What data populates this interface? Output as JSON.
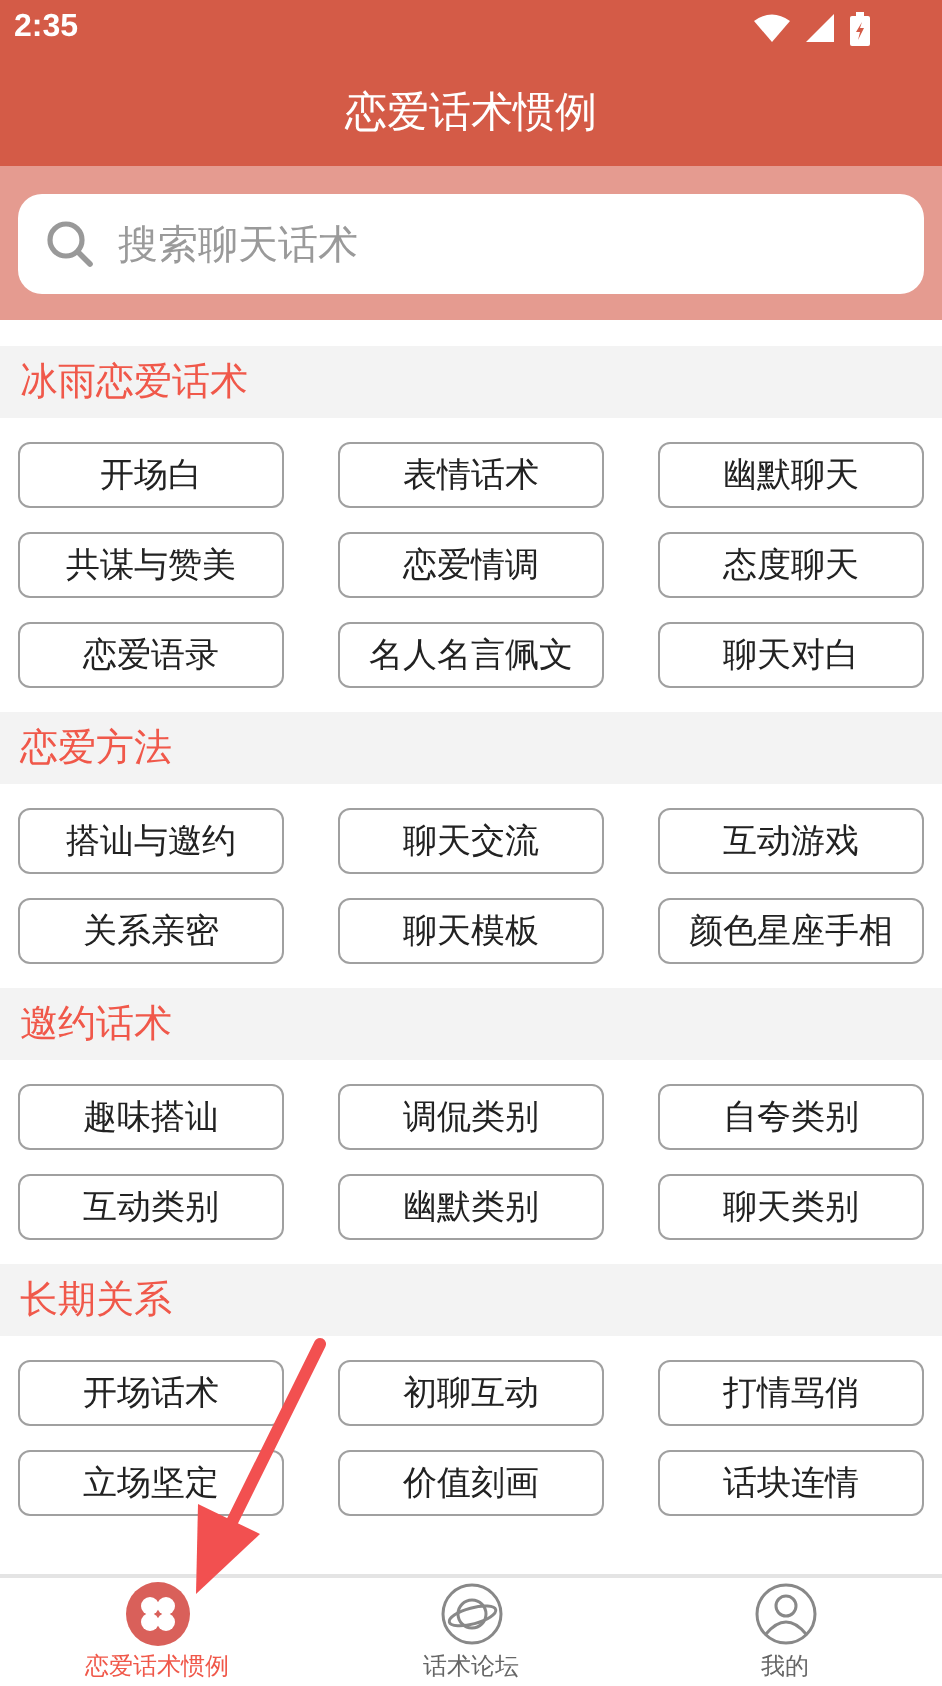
{
  "status_bar": {
    "time": "2:35"
  },
  "header": {
    "title": "恋爱话术惯例"
  },
  "search": {
    "placeholder": "搜索聊天话术"
  },
  "sections": [
    {
      "title": "冰雨恋爱话术",
      "items": [
        "开场白",
        "表情话术",
        "幽默聊天",
        "共谋与赞美",
        "恋爱情调",
        "态度聊天",
        "恋爱语录",
        "名人名言佩文",
        "聊天对白"
      ]
    },
    {
      "title": "恋爱方法",
      "items": [
        "搭讪与邀约",
        "聊天交流",
        "互动游戏",
        "关系亲密",
        "聊天模板",
        "颜色星座手相"
      ]
    },
    {
      "title": "邀约话术",
      "items": [
        "趣味搭讪",
        "调侃类别",
        "自夸类别",
        "互动类别",
        "幽默类别",
        "聊天类别"
      ]
    },
    {
      "title": "长期关系",
      "items": [
        "开场话术",
        "初聊互动",
        "打情骂俏",
        "立场坚定",
        "价值刻画",
        "话块连情"
      ]
    }
  ],
  "tab_bar": [
    {
      "label": "恋爱话术惯例",
      "kind": "clover",
      "selected": true
    },
    {
      "label": "话术论坛",
      "kind": "planet",
      "selected": false
    },
    {
      "label": "我的",
      "kind": "person",
      "selected": false
    }
  ],
  "annotation": {
    "kind": "arrow"
  }
}
